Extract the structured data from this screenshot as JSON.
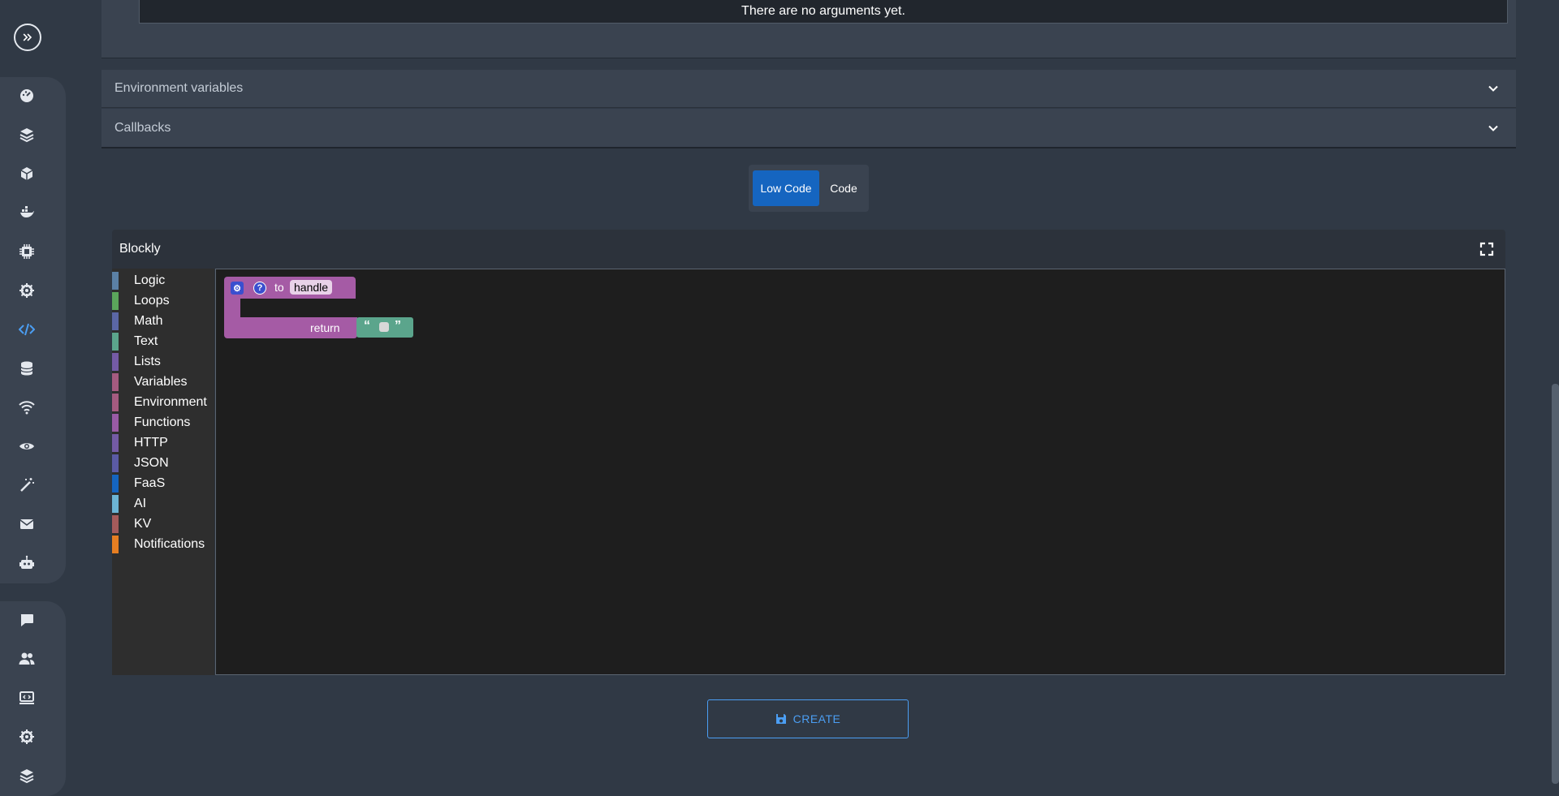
{
  "sidebar": {
    "expand_icon": "chevrons-right-icon",
    "group1": [
      "dashboard-icon",
      "layers-icon",
      "cube-icon",
      "docker-icon",
      "chip-icon",
      "helm-icon",
      "code-icon",
      "database-icon",
      "wifi-icon",
      "eye-icon",
      "magic-wand-icon",
      "mail-icon",
      "robot-icon"
    ],
    "group2": [
      "chat-icon",
      "users-icon",
      "monitor-code-icon",
      "helm-icon",
      "layers-icon"
    ],
    "active": "code-icon",
    "active_color": "#4b9ef3"
  },
  "arguments": {
    "empty_text": "There are no arguments yet."
  },
  "accordions": {
    "env": {
      "title": "Environment variables"
    },
    "callbacks": {
      "title": "Callbacks"
    }
  },
  "mode_toggle": {
    "low_code": "Low Code",
    "code": "Code",
    "selected": "Low Code"
  },
  "blockly": {
    "title": "Blockly",
    "fullscreen_icon": "fullscreen-icon",
    "categories": [
      {
        "label": "Logic",
        "color": "#5b80a5"
      },
      {
        "label": "Loops",
        "color": "#5ba55b"
      },
      {
        "label": "Math",
        "color": "#5b67a5"
      },
      {
        "label": "Text",
        "color": "#5ba58c"
      },
      {
        "label": "Lists",
        "color": "#745ba5"
      },
      {
        "label": "Variables",
        "color": "#a55b80"
      },
      {
        "label": "Environment",
        "color": "#a55b80"
      },
      {
        "label": "Functions",
        "color": "#995ba5"
      },
      {
        "label": "HTTP",
        "color": "#745ba5"
      },
      {
        "label": "JSON",
        "color": "#5b5ba5"
      },
      {
        "label": "FaaS",
        "color": "#1565c0"
      },
      {
        "label": "AI",
        "color": "#6cb4d4"
      },
      {
        "label": "KV",
        "color": "#a55b5b"
      },
      {
        "label": "Notifications",
        "color": "#e67e22"
      }
    ],
    "function_block": {
      "to_label": "to",
      "name": "handle",
      "return_label": "return",
      "gear_icon": "gear-icon",
      "help_icon": "question-icon",
      "open_quote": "“",
      "close_quote": "”"
    }
  },
  "create_button": {
    "label": "CREATE",
    "icon": "save-icon"
  }
}
